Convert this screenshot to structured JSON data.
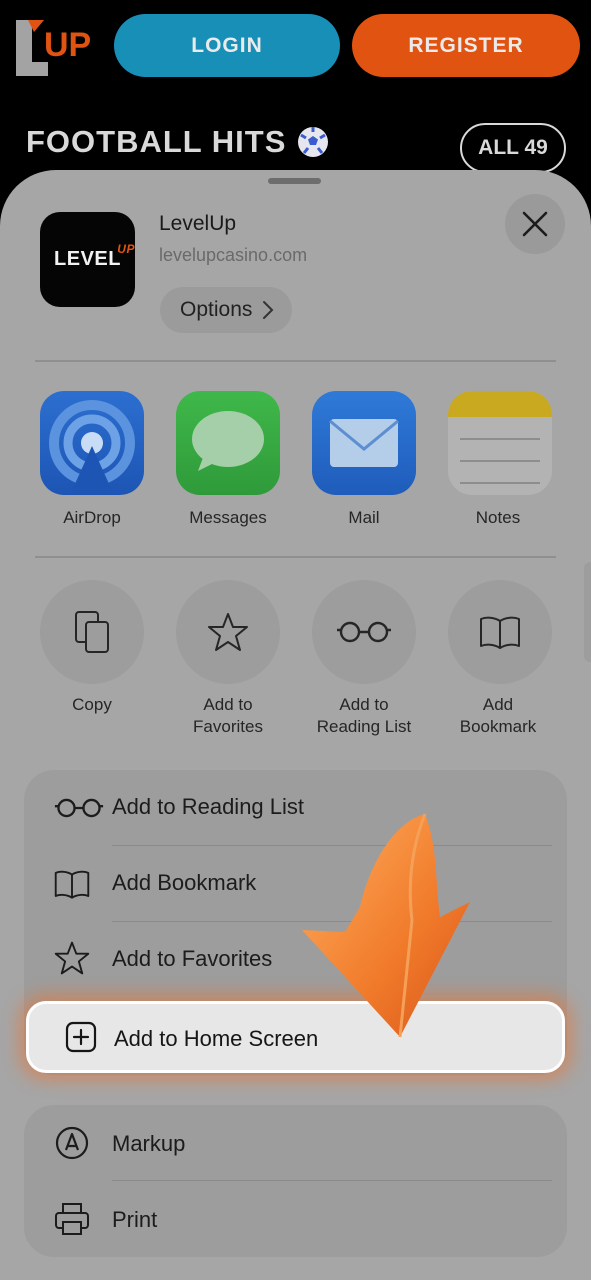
{
  "site": {
    "logo_text": "UP",
    "login_label": "LOGIN",
    "register_label": "REGISTER",
    "section_title": "FOOTBALL HITS",
    "all_label": "ALL 49",
    "colors": {
      "login": "#178fb7",
      "register": "#e05310",
      "logo_accent": "#e05310"
    }
  },
  "share_sheet": {
    "app": {
      "name": "LevelUp",
      "url": "levelupcasino.com",
      "icon_text": "LEVEL",
      "icon_accent": "UP"
    },
    "options_label": "Options",
    "apps": [
      {
        "label": "AirDrop",
        "icon": "airdrop-icon"
      },
      {
        "label": "Messages",
        "icon": "messages-icon"
      },
      {
        "label": "Mail",
        "icon": "mail-icon"
      },
      {
        "label": "Notes",
        "icon": "notes-icon"
      }
    ],
    "actions": [
      {
        "label_lines": [
          "Copy"
        ],
        "icon": "copy-icon"
      },
      {
        "label_lines": [
          "Add to",
          "Favorites"
        ],
        "icon": "star-icon"
      },
      {
        "label_lines": [
          "Add to",
          "Reading List"
        ],
        "icon": "glasses-icon"
      },
      {
        "label_lines": [
          "Add",
          "Bookmark"
        ],
        "icon": "book-icon"
      }
    ],
    "list_group_1": [
      {
        "label": "Add to Reading List",
        "icon": "glasses-icon"
      },
      {
        "label": "Add Bookmark",
        "icon": "book-icon"
      },
      {
        "label": "Add to Favorites",
        "icon": "star-icon"
      }
    ],
    "highlighted": {
      "label": "Add to Home Screen",
      "icon": "plus-square-icon"
    },
    "list_group_2": [
      {
        "label": "Markup",
        "icon": "markup-icon"
      },
      {
        "label": "Print",
        "icon": "printer-icon"
      }
    ]
  }
}
